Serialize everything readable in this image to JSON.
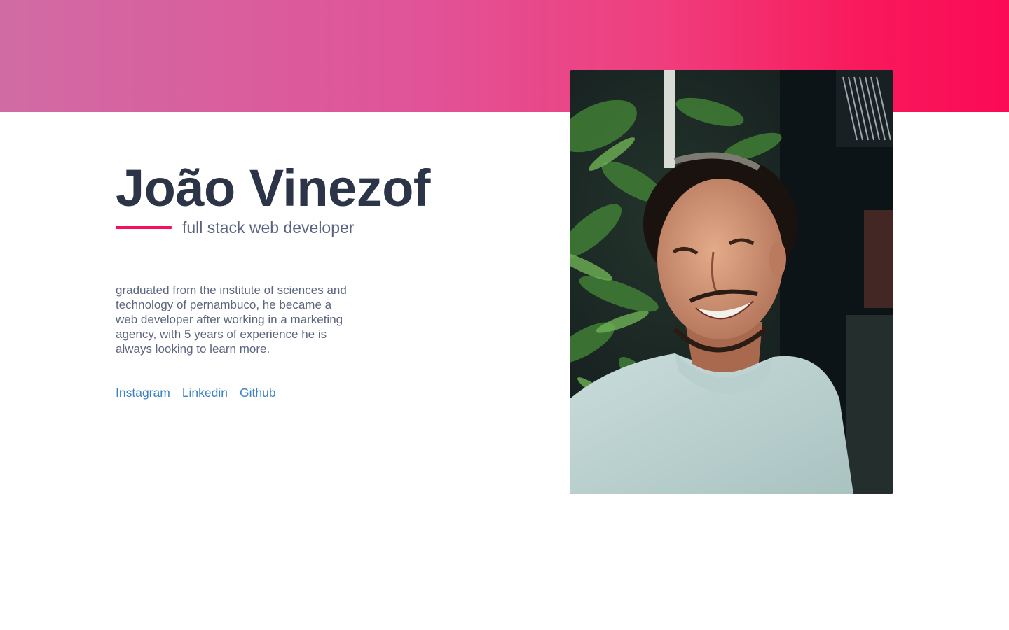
{
  "profile": {
    "name": "João Vinezof",
    "role": "full stack web developer",
    "bio": "graduated from the institute of sciences and technology of pernambuco, he became a web developer after working in a marketing agency, with 5 years of experience he is always looking to learn more."
  },
  "social": {
    "instagram": "Instagram",
    "linkedin": "Linkedin",
    "github": "Github"
  },
  "colors": {
    "band_start": "#d16ba5",
    "band_end": "#fb0a55",
    "accent": "#f4115c",
    "heading": "#2c3448",
    "link": "#3b82c4"
  },
  "photo": {
    "icon": "portrait-photo"
  }
}
